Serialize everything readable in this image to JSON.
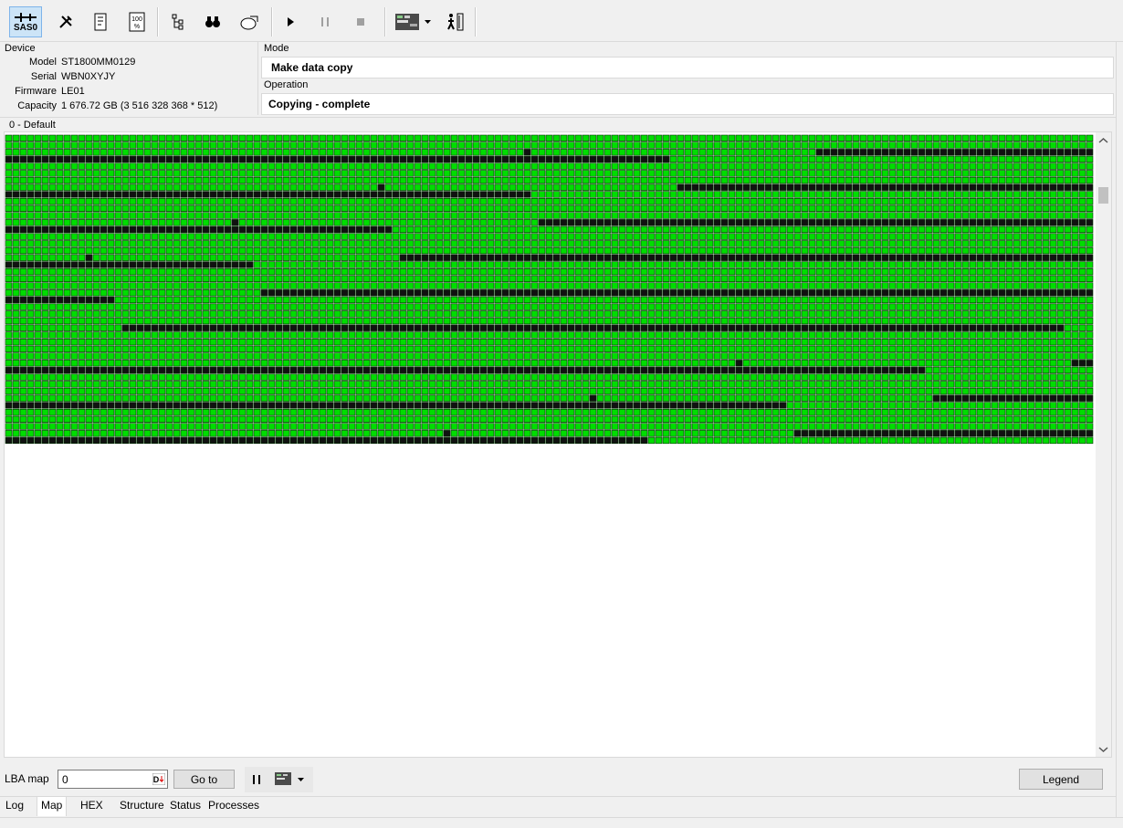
{
  "toolbar": {
    "device_label": "SAS0",
    "icons": [
      "sas-device-icon",
      "tools-icon",
      "scroll-log-icon",
      "percent-icon",
      "tree-icon",
      "binoculars-icon",
      "disk-export-icon",
      "play-icon",
      "pause-icon",
      "stop-icon",
      "map-view-icon",
      "dropdown-icon",
      "exit-icon"
    ]
  },
  "device": {
    "heading": "Device",
    "fields": [
      {
        "label": "Model",
        "value": "ST1800MM0129"
      },
      {
        "label": "Serial",
        "value": "WBN0XYJY"
      },
      {
        "label": "Firmware",
        "value": "LE01"
      },
      {
        "label": "Capacity",
        "value": "1 676.72 GB (3 516 328 368 * 512)"
      }
    ]
  },
  "mode": {
    "heading": "Mode",
    "value": "Make data copy"
  },
  "operation": {
    "heading": "Operation",
    "value": "Copying - complete"
  },
  "map": {
    "title": "0 - Default",
    "colors": {
      "read": "#00dd00",
      "unread": "#111111",
      "border": "#003300"
    },
    "rows": 44,
    "cols": 149,
    "unread_ranges": [
      [
        2,
        71,
        72
      ],
      [
        2,
        111,
        149
      ],
      [
        3,
        0,
        91
      ],
      [
        7,
        51,
        52
      ],
      [
        7,
        92,
        149
      ],
      [
        8,
        0,
        72
      ],
      [
        12,
        31,
        32
      ],
      [
        12,
        73,
        149
      ],
      [
        13,
        0,
        53
      ],
      [
        17,
        11,
        12
      ],
      [
        17,
        54,
        149
      ],
      [
        18,
        0,
        34
      ],
      [
        22,
        140,
        141
      ],
      [
        22,
        35,
        149
      ],
      [
        23,
        0,
        15
      ],
      [
        27,
        120,
        121
      ],
      [
        27,
        16,
        145
      ],
      [
        32,
        146,
        149
      ],
      [
        32,
        100,
        101
      ],
      [
        33,
        0,
        126
      ],
      [
        37,
        80,
        81
      ],
      [
        37,
        127,
        149
      ],
      [
        38,
        0,
        107
      ],
      [
        42,
        60,
        61
      ],
      [
        42,
        108,
        149
      ],
      [
        43,
        0,
        88
      ]
    ]
  },
  "bottom": {
    "lba_label": "LBA map",
    "lba_value": "0",
    "goto_label": "Go to",
    "legend_label": "Legend"
  },
  "tabs": [
    "Log",
    "Map",
    "HEX",
    "Structure",
    "Status",
    "Processes"
  ],
  "selected_tab": "Map"
}
